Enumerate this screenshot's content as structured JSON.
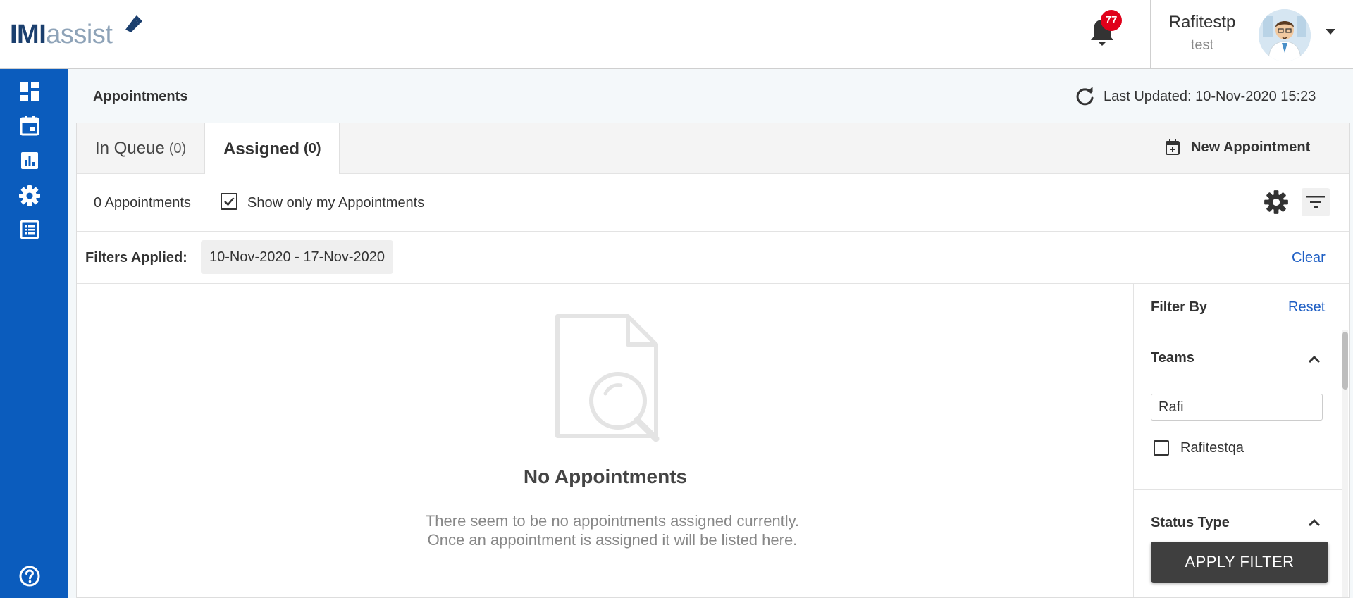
{
  "brand": {
    "logo_bold": "IMI",
    "logo_light": "assist"
  },
  "header": {
    "notification_count": "77",
    "user_name": "Rafitestp",
    "user_role": "test"
  },
  "nav": {
    "items": [
      {
        "icon": "dashboard-icon"
      },
      {
        "icon": "calendar-icon"
      },
      {
        "icon": "bar-chart-icon"
      },
      {
        "icon": "gear-icon"
      },
      {
        "icon": "list-icon"
      }
    ],
    "help_icon": "help-icon"
  },
  "page": {
    "title": "Appointments",
    "last_updated": "Last Updated: 10-Nov-2020 15:23"
  },
  "tabs": [
    {
      "label": "In Queue",
      "count": "(0)",
      "active": false
    },
    {
      "label": "Assigned",
      "count": "(0)",
      "active": true
    }
  ],
  "new_appointment_label": "New Appointment",
  "toolbar": {
    "appointment_count": "0 Appointments",
    "show_only_mine_label": "Show only my Appointments",
    "show_only_mine_checked": true
  },
  "filters_applied": {
    "label": "Filters Applied:",
    "chip": "10-Nov-2020 - 17-Nov-2020",
    "clear_label": "Clear"
  },
  "empty_state": {
    "title": "No Appointments",
    "description": "There seem to be no appointments assigned currently. Once an appointment is assigned it will be listed here."
  },
  "filter_panel": {
    "title": "Filter By",
    "reset_label": "Reset",
    "teams_title": "Teams",
    "teams_search_value": "Rafi",
    "team_option": "Rafitestqa",
    "status_title": "Status Type",
    "apply_label": "APPLY FILTER"
  },
  "colors": {
    "sidebar": "#0b5cbd",
    "badge": "#e0001a",
    "link": "#1f5fc4",
    "apply_button": "#3f3f3f"
  }
}
